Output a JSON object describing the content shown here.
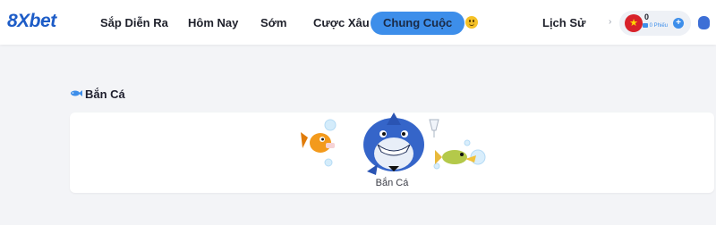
{
  "header": {
    "logo": "8Xbet",
    "nav": [
      {
        "label": "Sắp Diễn Ra"
      },
      {
        "label": "Hôm Nay"
      },
      {
        "label": "Sớm"
      },
      {
        "label": "Cược Xâu"
      },
      {
        "label": "Chung Cuộc",
        "active": true
      }
    ],
    "history_label": "Lịch Sử",
    "balance": {
      "amount": "0",
      "sub": "0 Phiếu",
      "flag_icon": "vietnam-flag-icon"
    },
    "icons": {
      "emoji": "smiley-emoji-icon",
      "chevron": "chevron-right-icon",
      "add": "plus-icon",
      "wallet": "money-bag-icon"
    },
    "accent_color": "#3d8eea",
    "brand_color": "#1d5cc7"
  },
  "section": {
    "title": "Bắn Cá",
    "icon": "fish-icon",
    "games": [
      {
        "label": "Bắn Cá",
        "image": "shark-fish-game-art"
      }
    ]
  }
}
